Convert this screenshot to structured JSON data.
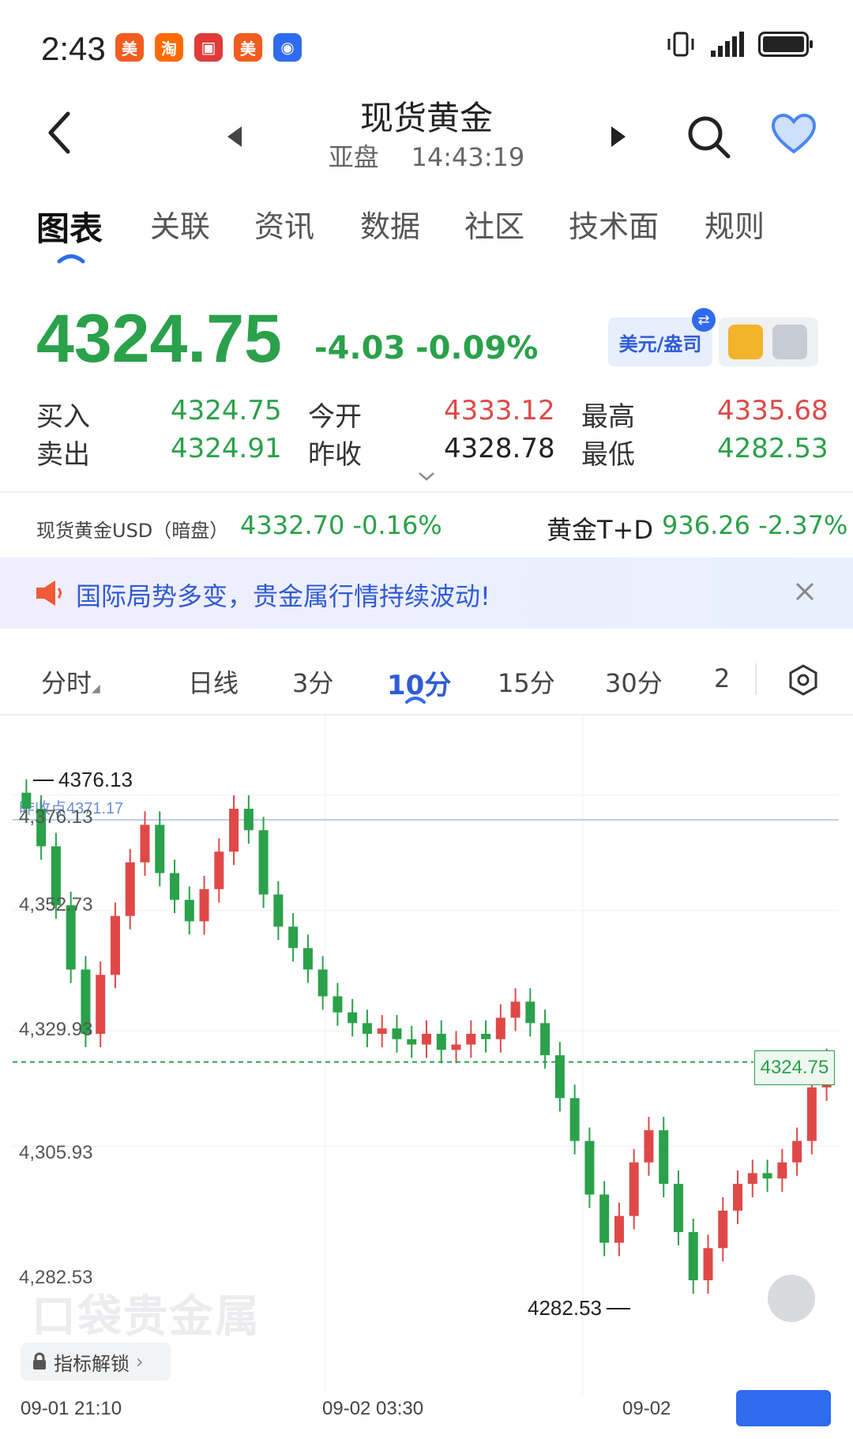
{
  "status_bar": {
    "time": "2:43",
    "apps": [
      {
        "name": "meituan-icon",
        "glyph": "美",
        "color": "#f25c1f"
      },
      {
        "name": "taobao-icon",
        "glyph": "淘",
        "color": "#ff6a00"
      },
      {
        "name": "tv-app-icon",
        "glyph": "▣",
        "color": "#e03a3a"
      },
      {
        "name": "meituan-icon-2",
        "glyph": "美",
        "color": "#f25c1f"
      },
      {
        "name": "bulb-app-icon",
        "glyph": "◉",
        "color": "#2f6bf0"
      }
    ]
  },
  "header": {
    "title": "现货黄金",
    "session": "亚盘",
    "clock": "14:43:19"
  },
  "tabs": [
    "图表",
    "关联",
    "资讯",
    "数据",
    "社区",
    "技术面",
    "规则"
  ],
  "quote": {
    "last": "4324.75",
    "change": "-4.03",
    "change_pct": "-0.09%",
    "currency_button": "美元/盎司",
    "rows": [
      {
        "l1": "买入",
        "v1": "4324.75",
        "l2": "今开",
        "v2": "4333.12",
        "l3": "最高",
        "v3": "4335.68"
      },
      {
        "l1": "卖出",
        "v1": "4324.91",
        "l2": "昨收",
        "v2": "4328.78",
        "l3": "最低",
        "v3": "4282.53"
      }
    ]
  },
  "related": {
    "left_label": "现货黄金USD（暗盘）",
    "left_value": "4332.70 -0.16%",
    "right_label": "黄金T+D",
    "right_value": "936.26 -2.37%"
  },
  "notice": {
    "text": "国际局势多变，贵金属行情持续波动!"
  },
  "periods": {
    "items": [
      "分时",
      "日线",
      "3分",
      "10分",
      "15分",
      "30分",
      "2"
    ],
    "active": "10分"
  },
  "chart_data": {
    "type": "candlestick",
    "y_ticks": [
      "4,376.13",
      "4,352.73",
      "4,329.93",
      "4,305.93",
      "4,282.53"
    ],
    "ylim": [
      4282.53,
      4376.13
    ],
    "x_ticks": [
      "09-01 21:10",
      "09-02 03:30",
      "09-02"
    ],
    "high_marker": "4376.13",
    "low_marker": "4282.53",
    "ref_line_label": "昨收点4371.17",
    "last_price_tag": "4324.75",
    "closes": [
      4372,
      4365,
      4354,
      4342,
      4330,
      4341,
      4352,
      4362,
      4369,
      4360,
      4355,
      4351,
      4357,
      4364,
      4372,
      4368,
      4356,
      4350,
      4346,
      4342,
      4337,
      4334,
      4332,
      4330,
      4331,
      4329,
      4328,
      4330,
      4327,
      4328,
      4330,
      4329,
      4333,
      4336,
      4332,
      4326,
      4318,
      4310,
      4300,
      4291,
      4296,
      4306,
      4312,
      4302,
      4293,
      4284,
      4290,
      4297,
      4302,
      4304,
      4303,
      4306,
      4310,
      4320,
      4324.75
    ],
    "colors": {
      "up": "#e04848",
      "down": "#2aa14a"
    }
  },
  "chart_ui": {
    "unlock_label": "指标解锁",
    "watermark": "口袋贵金属"
  }
}
